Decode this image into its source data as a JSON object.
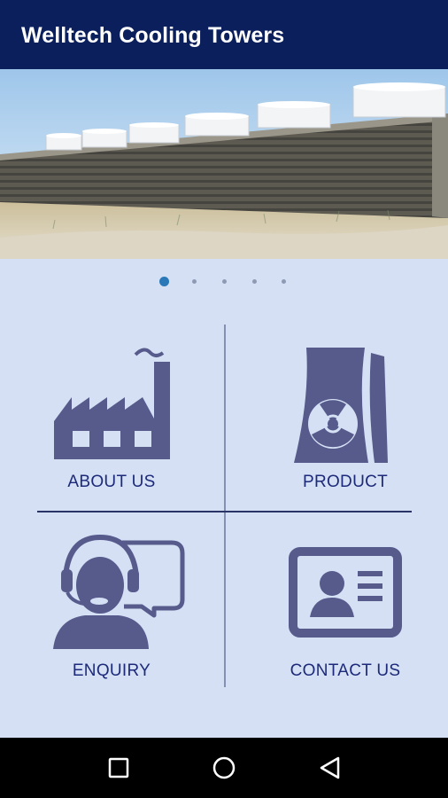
{
  "app_title": "Welltech Cooling Towers",
  "banner": {
    "icon": "cooling-tower-photo",
    "slides_total": 5,
    "active_slide": 1
  },
  "menu": {
    "about": {
      "label": "ABOUT US",
      "icon": "factory-icon"
    },
    "product": {
      "label": "PRODUCT",
      "icon": "nuclear-cooling-tower-icon"
    },
    "enquiry": {
      "label": "ENQUIRY",
      "icon": "headset-agent-icon"
    },
    "contact": {
      "label": "CONTACT US",
      "icon": "contact-card-icon"
    }
  },
  "nav": {
    "recents": "square-icon",
    "home": "circle-icon",
    "back": "triangle-back-icon"
  },
  "colors": {
    "app_bar": "#0b1f5c",
    "background": "#d5e0f5",
    "icon": "#565b8c",
    "label": "#1d2a7a",
    "active_dot": "#2a78b7"
  }
}
